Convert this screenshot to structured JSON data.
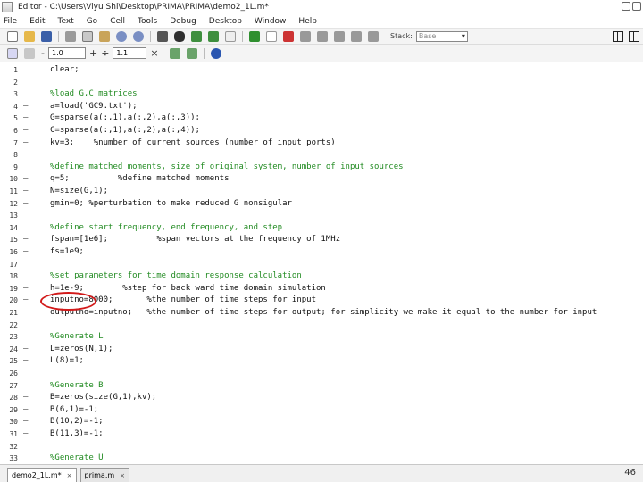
{
  "window": {
    "title": "Editor - C:\\Users\\Viyu Shi\\Desktop\\PRIMA\\PRIMA\\demo2_1L.m*"
  },
  "menu": [
    "File",
    "Edit",
    "Text",
    "Go",
    "Cell",
    "Tools",
    "Debug",
    "Desktop",
    "Window",
    "Help"
  ],
  "toolbar": {
    "icons": [
      "new-file-icon",
      "open-folder-icon",
      "save-icon",
      "cut-icon",
      "copy-icon",
      "paste-icon",
      "undo-icon",
      "redo-icon",
      "print-icon",
      "find-icon",
      "back-icon",
      "forward-icon",
      "function-icon",
      "run-icon",
      "breakpoint-set-icon",
      "breakpoint-clear-icon",
      "step-icon",
      "step-in-icon",
      "step-out-icon",
      "continue-icon",
      "exit-debug-icon"
    ],
    "stack_label": "Stack:",
    "stack_value": "Base"
  },
  "cell_toolbar": {
    "decrement": "-",
    "value1": "1.0",
    "increment": "+",
    "divide": "÷",
    "value2": "1.1",
    "multiply": "×"
  },
  "code_lines": [
    {
      "n": "1",
      "bp": "",
      "text": "clear;",
      "type": "normal"
    },
    {
      "n": "2",
      "bp": "",
      "text": "",
      "type": "normal"
    },
    {
      "n": "3",
      "bp": "",
      "text": "%load G,C matrices",
      "type": "comment"
    },
    {
      "n": "4",
      "bp": "—",
      "text": "a=load('GC9.txt');",
      "type": "normal"
    },
    {
      "n": "5",
      "bp": "—",
      "text": "G=sparse(a(:,1),a(:,2),a(:,3));",
      "type": "normal"
    },
    {
      "n": "6",
      "bp": "—",
      "text": "C=sparse(a(:,1),a(:,2),a(:,4));",
      "type": "normal"
    },
    {
      "n": "7",
      "bp": "—",
      "text": "kv=3;    %number of current sources (number of input ports)",
      "type": "normal"
    },
    {
      "n": "8",
      "bp": "",
      "text": "",
      "type": "normal"
    },
    {
      "n": "9",
      "bp": "",
      "text": "%define matched moments, size of original system, number of input sources",
      "type": "comment"
    },
    {
      "n": "10",
      "bp": "—",
      "text": "q=5;          %define matched moments",
      "type": "normal"
    },
    {
      "n": "11",
      "bp": "—",
      "text": "N=size(G,1);",
      "type": "normal"
    },
    {
      "n": "12",
      "bp": "—",
      "text": "gmin=0; %perturbation to make reduced G nonsigular",
      "type": "normal"
    },
    {
      "n": "13",
      "bp": "",
      "text": "",
      "type": "normal"
    },
    {
      "n": "14",
      "bp": "",
      "text": "%define start frequency, end frequency, and step",
      "type": "comment"
    },
    {
      "n": "15",
      "bp": "—",
      "text": "fspan=[1e6];          %span vectors at the frequency of 1MHz",
      "type": "normal"
    },
    {
      "n": "16",
      "bp": "—",
      "text": "fs=1e9;",
      "type": "normal"
    },
    {
      "n": "17",
      "bp": "",
      "text": "",
      "type": "normal"
    },
    {
      "n": "18",
      "bp": "",
      "text": "%set parameters for time domain response calculation",
      "type": "comment"
    },
    {
      "n": "19",
      "bp": "—",
      "text": "h=1e-9;        %step for back ward time domain simulation",
      "type": "normal"
    },
    {
      "n": "20",
      "bp": "—",
      "text": "inputno=8000;       %the number of time steps for input",
      "type": "normal"
    },
    {
      "n": "21",
      "bp": "—",
      "text": "outputno=inputno;   %the number of time steps for output; for simplicity we make it equal to the number for input",
      "type": "normal"
    },
    {
      "n": "22",
      "bp": "",
      "text": "",
      "type": "normal"
    },
    {
      "n": "23",
      "bp": "",
      "text": "%Generate L",
      "type": "comment"
    },
    {
      "n": "24",
      "bp": "—",
      "text": "L=zeros(N,1);",
      "type": "normal"
    },
    {
      "n": "25",
      "bp": "—",
      "text": "L(8)=1;",
      "type": "normal"
    },
    {
      "n": "26",
      "bp": "",
      "text": "",
      "type": "normal"
    },
    {
      "n": "27",
      "bp": "",
      "text": "%Generate B",
      "type": "comment"
    },
    {
      "n": "28",
      "bp": "—",
      "text": "B=zeros(size(G,1),kv);",
      "type": "normal"
    },
    {
      "n": "29",
      "bp": "—",
      "text": "B(6,1)=-1;",
      "type": "normal"
    },
    {
      "n": "30",
      "bp": "—",
      "text": "B(10,2)=-1;",
      "type": "normal"
    },
    {
      "n": "31",
      "bp": "—",
      "text": "B(11,3)=-1;",
      "type": "normal"
    },
    {
      "n": "32",
      "bp": "",
      "text": "",
      "type": "normal"
    },
    {
      "n": "33",
      "bp": "",
      "text": "%Generate U",
      "type": "comment"
    }
  ],
  "tabs": [
    {
      "label": "demo2_1L.m*",
      "close": "×",
      "active": true
    },
    {
      "label": "prima.m",
      "close": "×",
      "active": false
    }
  ],
  "page_number": "46",
  "colors": {
    "comment": "#228b22",
    "highlight": "#d21a1a"
  }
}
